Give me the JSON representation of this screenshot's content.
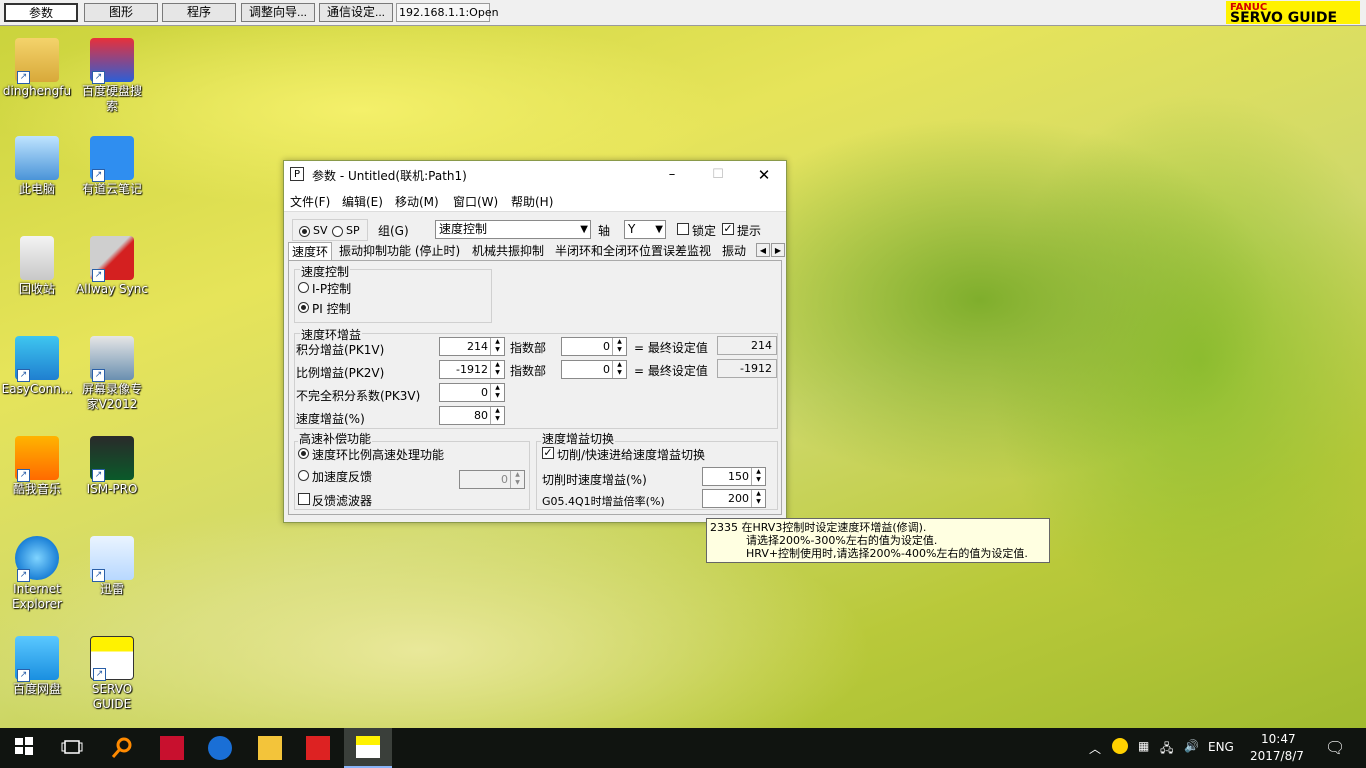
{
  "toolbar": {
    "buttons": [
      "参数",
      "图形",
      "程序",
      "调整向导...",
      "通信设定..."
    ],
    "status": "192.168.1.1:Open",
    "logo_top": "FANUC",
    "logo_bottom": "SERVO GUIDE"
  },
  "desktop_icons": [
    {
      "label": "dinghengfu"
    },
    {
      "label": "百度硬盘搜\n索"
    },
    {
      "label": "此电脑"
    },
    {
      "label": "有道云笔记"
    },
    {
      "label": "回收站"
    },
    {
      "label": "Allway Sync"
    },
    {
      "label": "EasyConn..."
    },
    {
      "label": "屏幕录像专\n家V2012"
    },
    {
      "label": "酷我音乐"
    },
    {
      "label": "ISM-PRO"
    },
    {
      "label": "Internet\nExplorer"
    },
    {
      "label": "迅雷"
    },
    {
      "label": "百度网盘"
    },
    {
      "label": "SERVO\nGUIDE"
    }
  ],
  "window": {
    "title": "参数 - Untitled(联机:Path1)",
    "app_icon": "P",
    "menu": [
      "文件(F)",
      "编辑(E)",
      "移动(M)",
      "窗口(W)",
      "帮助(H)"
    ],
    "mode_sv": "SV",
    "mode_sp": "SP",
    "group_label": "组(G)",
    "group_value": "速度控制",
    "axis_label": "轴",
    "axis_value": "Y",
    "lock_label": "锁定",
    "hint_label": "提示",
    "tabs": [
      "速度环",
      "振动抑制功能 (停止时)",
      "机械共振抑制",
      "半闭环和全闭环位置误差监视",
      "振动"
    ],
    "speed_control": {
      "title": "速度控制",
      "ip": "I-P控制",
      "pi": "PI 控制"
    },
    "gain": {
      "title": "速度环增益",
      "pk1v_label": "积分增益(PK1V)",
      "pk1v_value": "214",
      "exp_label": "指数部",
      "pk1v_exp": "0",
      "final_label": "= 最终设定值",
      "pk1v_final": "214",
      "pk2v_label": "比例增益(PK2V)",
      "pk2v_value": "-1912",
      "pk2v_exp": "0",
      "pk2v_final": "-1912",
      "pk3v_label": "不完全积分系数(PK3V)",
      "pk3v_value": "0",
      "vg_label": "速度增益(%)",
      "vg_value": "80"
    },
    "highspeed": {
      "title": "高速补偿功能",
      "opt1": "速度环比例高速处理功能",
      "opt2": "加速度反馈",
      "opt2_value": "0",
      "filter": "反馈滤波器"
    },
    "switch": {
      "title": "速度增益切换",
      "check_label": "切削/快速进给速度增益切换",
      "cut_label": "切削时速度增益(%)",
      "cut_value": "150",
      "g05_label": "G05.4Q1时增益倍率(%)",
      "g05_value": "200"
    }
  },
  "tooltip": {
    "line1": "2335 在HRV3控制时设定速度环增益(修调).",
    "line2": "请选择200%-300%左右的值为设定值.",
    "line3": "HRV+控制使用时,请选择200%-400%左右的值为设定值."
  },
  "taskbar": {
    "lang": "ENG",
    "time": "10:47",
    "date": "2017/8/7"
  }
}
